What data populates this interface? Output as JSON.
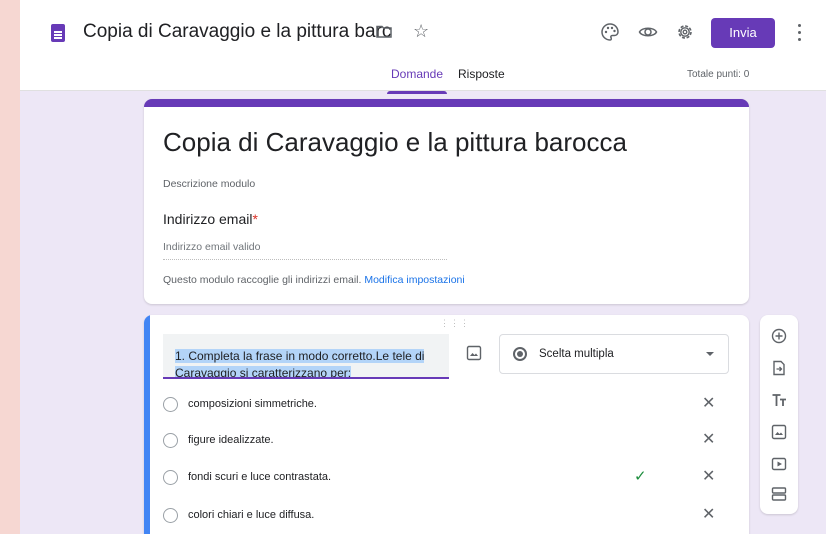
{
  "header": {
    "doc_title": "Copia di Caravaggio e la pittura barc",
    "send_label": "Invia",
    "tabs": [
      {
        "label": "Domande",
        "active": true
      },
      {
        "label": "Risposte",
        "active": false
      }
    ],
    "points": "Totale punti: 0"
  },
  "form": {
    "title": "Copia di Caravaggio e la pittura barocca",
    "description": "Descrizione modulo",
    "email_label": "Indirizzo email",
    "required_mark": "*",
    "email_placeholder": "Indirizzo email valido",
    "notice_text": "Questo modulo raccoglie gli indirizzi email.",
    "notice_link": "Modifica impostazioni"
  },
  "question": {
    "text": "1. Completa la frase in modo corretto.Le tele di Caravaggio si caratterizzano per:",
    "type_label": "Scelta multipla",
    "options": [
      {
        "label": "composizioni simmetriche.",
        "correct": false
      },
      {
        "label": "figure idealizzate.",
        "correct": false
      },
      {
        "label": "fondi scuri e luce contrastata.",
        "correct": true
      },
      {
        "label": "colori chiari e luce diffusa.",
        "correct": false
      }
    ],
    "check_glyph": "✓",
    "remove_glyph": "✕"
  },
  "colors": {
    "accent": "#673ab7",
    "active_question": "#4285f4",
    "correct": "#1e8e3e",
    "page_bg": "#ede7f6",
    "outer_bg": "#f6d7d2"
  },
  "icons": [
    "forms-doc-icon",
    "folder-icon",
    "star-icon",
    "palette-icon",
    "preview-eye-icon",
    "settings-gear-icon",
    "more-vert-icon",
    "drag-handle-icon",
    "image-icon",
    "add-question-icon",
    "import-questions-icon",
    "add-title-icon",
    "add-image-icon",
    "add-video-icon",
    "add-section-icon"
  ]
}
